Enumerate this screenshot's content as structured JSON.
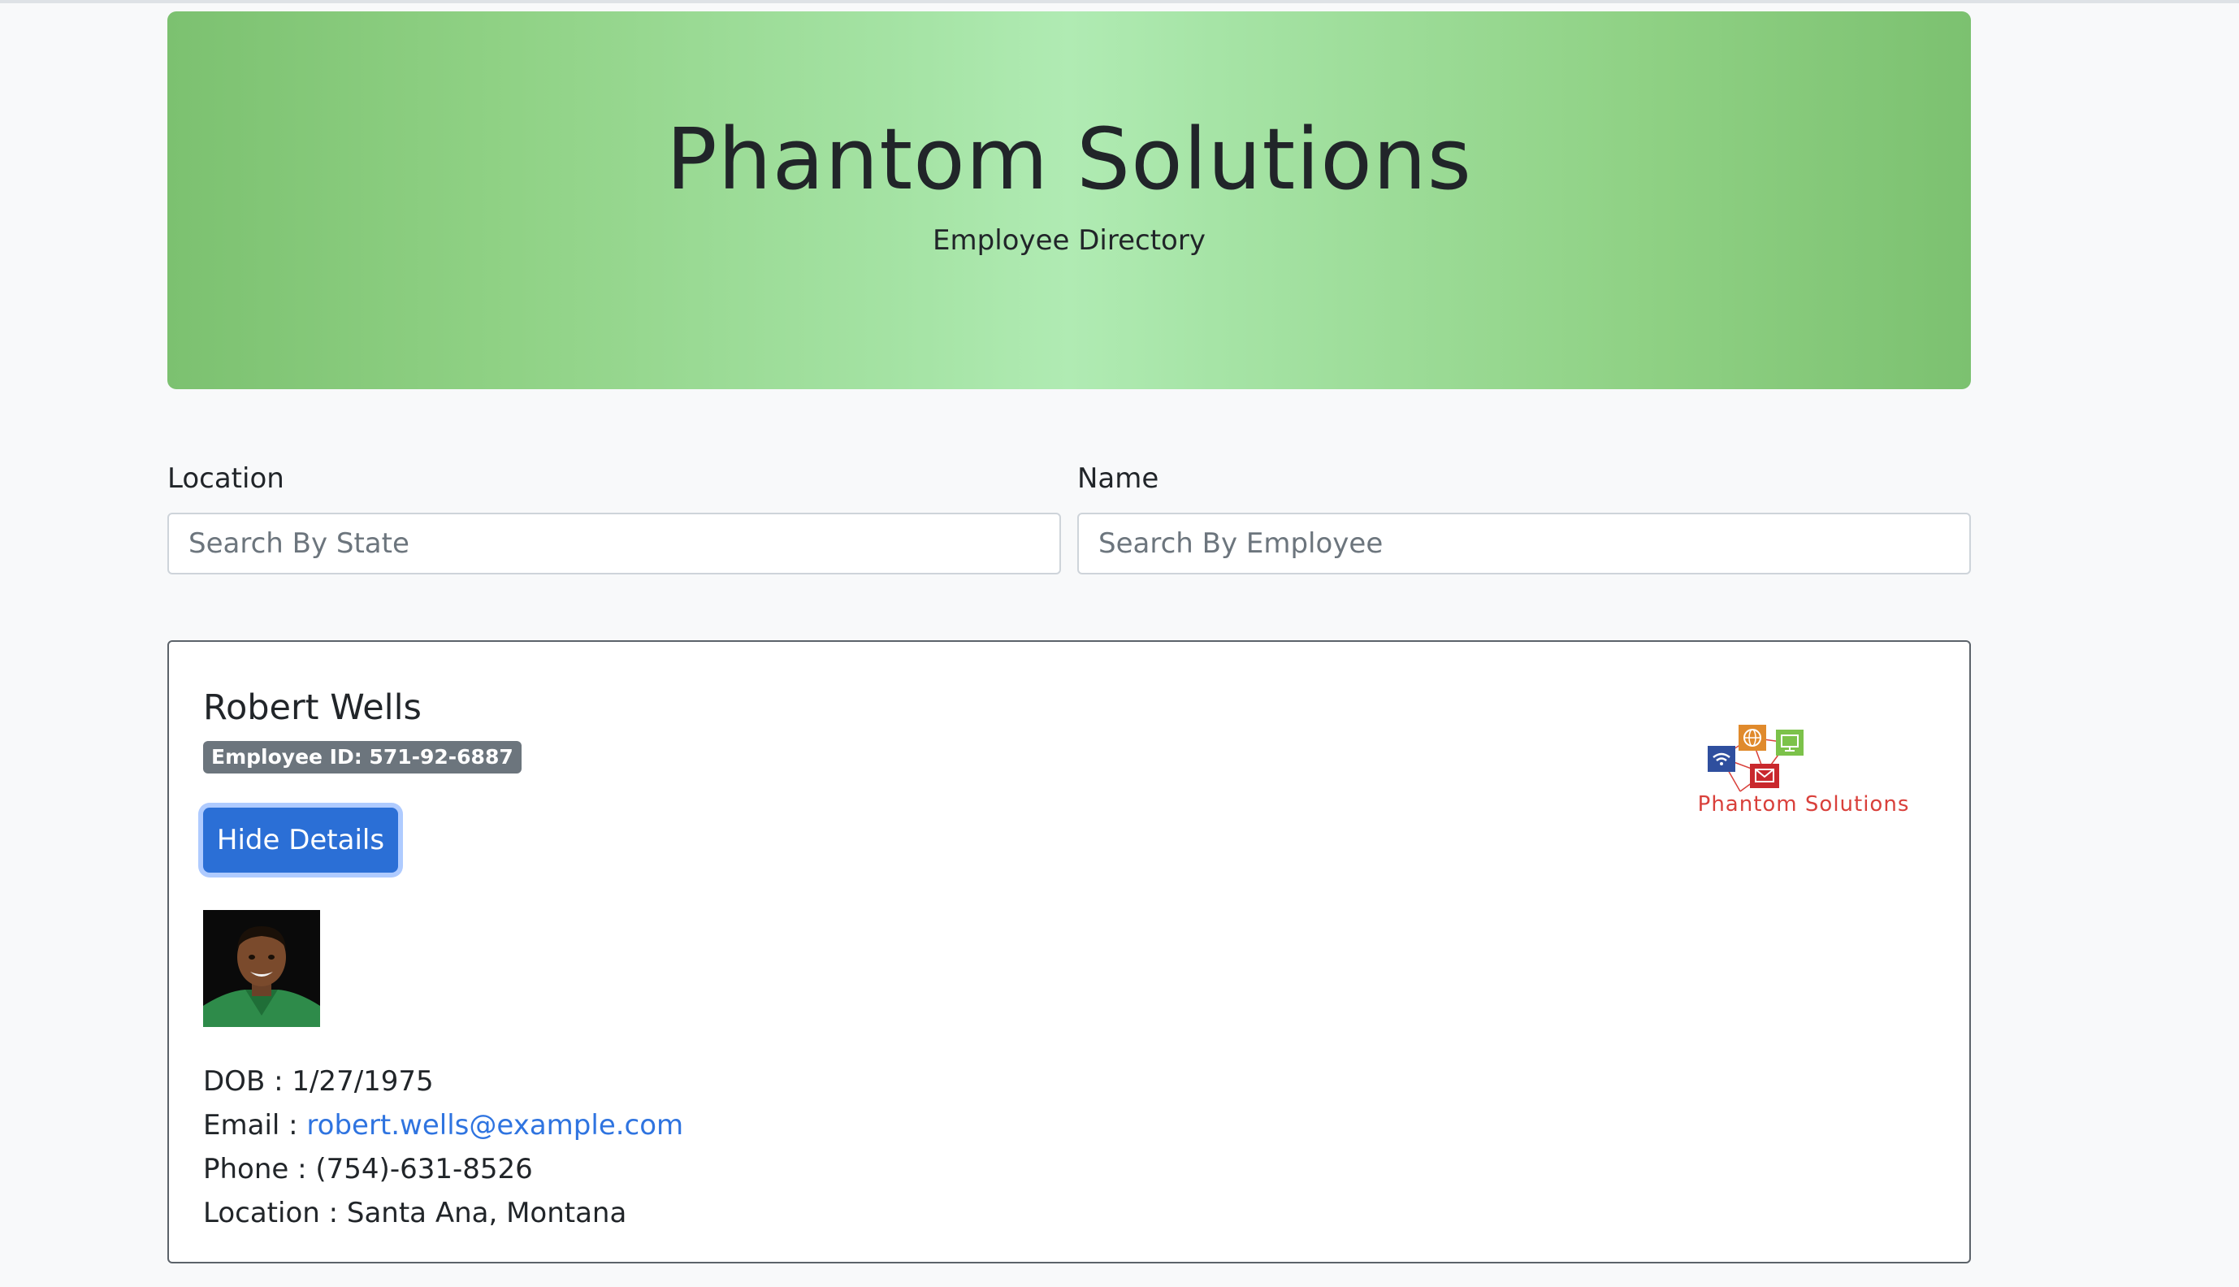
{
  "header": {
    "title": "Phantom Solutions",
    "subtitle": "Employee Directory"
  },
  "filters": {
    "location_label": "Location",
    "location_placeholder": "Search By State",
    "location_value": "",
    "name_label": "Name",
    "name_placeholder": "Search By Employee",
    "name_value": ""
  },
  "employee": {
    "name": "Robert Wells",
    "id_badge": "Employee ID: 571-92-6887",
    "toggle_label": "Hide Details",
    "dob_label": "DOB : ",
    "dob": "1/27/1975",
    "email_label": "Email : ",
    "email": "robert.wells@example.com",
    "phone_label": "Phone : ",
    "phone": "(754)-631-8526",
    "location_label": "Location : ",
    "location": "Santa Ana, Montana",
    "logo_text": "Phantom Solutions"
  },
  "colors": {
    "header_gradient_edge": "#7cc170",
    "header_gradient_center": "#b0ebb3",
    "primary_button": "#2b6fd6",
    "badge": "#6c757d",
    "link": "#2f74e0",
    "logo_red": "#d9403b"
  },
  "icons": [
    "wifi-icon",
    "globe-icon",
    "monitor-icon",
    "envelope-icon"
  ]
}
